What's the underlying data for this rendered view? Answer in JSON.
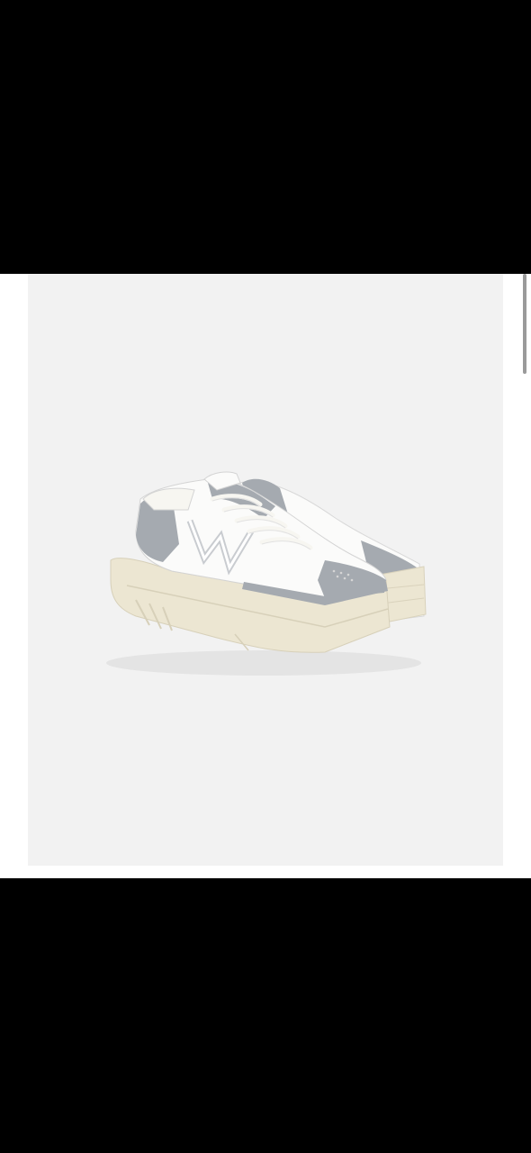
{
  "viewer": {
    "background_color": "#ffffff",
    "photo_background_color": "#f2f2f2",
    "photo_subject": "sneaker-pair-image",
    "colors": {
      "upper": "#fbfbfa",
      "suede": "#a5aab0",
      "sole": "#ece6d2",
      "laces": "#f7f6f1"
    }
  },
  "scrollbar": {
    "color": "#9a9a9a"
  }
}
